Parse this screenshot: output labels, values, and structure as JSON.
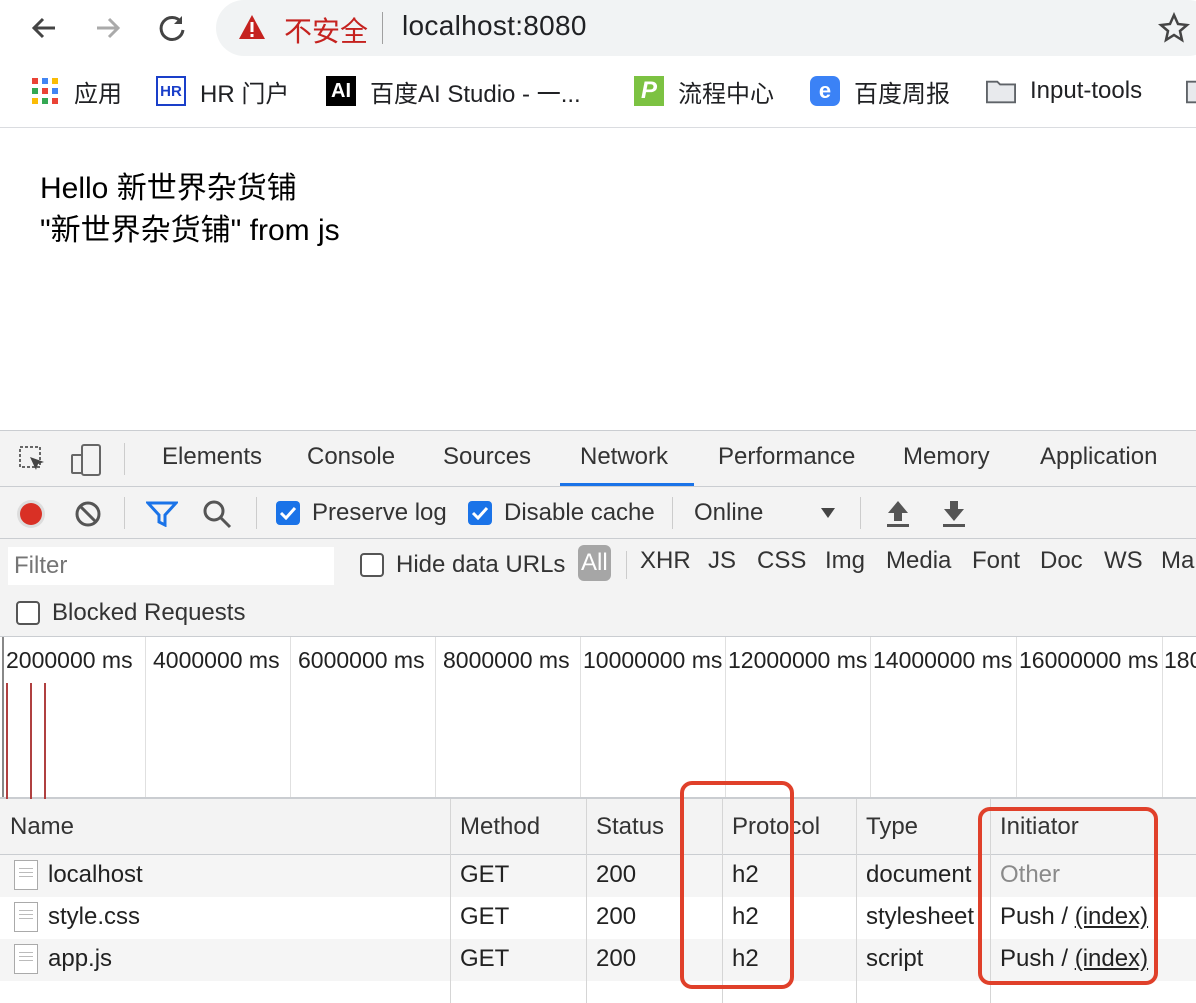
{
  "browser": {
    "insecure_label": "不安全",
    "url": "localhost:8080",
    "bookmarks": [
      {
        "icon": "apps-grid-icon",
        "label": "应用"
      },
      {
        "icon": "hr-portal-icon",
        "icon_text": "HR",
        "label": "HR 门户"
      },
      {
        "icon": "ai-studio-icon",
        "icon_text": "AI",
        "label": "百度AI Studio - 一..."
      },
      {
        "icon": "process-center-icon",
        "icon_text": "P",
        "label": "流程中心"
      },
      {
        "icon": "weekly-report-icon",
        "icon_text": "e",
        "label": "百度周报"
      },
      {
        "icon": "folder-icon",
        "label": "Input-tools"
      }
    ]
  },
  "page": {
    "line1": "Hello 新世界杂货铺",
    "line2": "\"新世界杂货铺\" from js"
  },
  "devtools": {
    "tabs": [
      "Elements",
      "Console",
      "Sources",
      "Network",
      "Performance",
      "Memory",
      "Application"
    ],
    "active_tab": "Network",
    "preserve_log": "Preserve log",
    "disable_cache": "Disable cache",
    "throttle": "Online",
    "filter_placeholder": "Filter",
    "hide_data_urls": "Hide data URLs",
    "type_filters": [
      "All",
      "XHR",
      "JS",
      "CSS",
      "Img",
      "Media",
      "Font",
      "Doc",
      "WS",
      "Ma"
    ],
    "blocked_requests": "Blocked Requests",
    "timeline_ticks": [
      "2000000 ms",
      "4000000 ms",
      "6000000 ms",
      "8000000 ms",
      "10000000 ms",
      "12000000 ms",
      "14000000 ms",
      "16000000 ms",
      "180"
    ],
    "columns": [
      "Name",
      "Method",
      "Status",
      "Protocol",
      "Type",
      "Initiator"
    ],
    "rows": [
      {
        "name": "localhost",
        "method": "GET",
        "status": "200",
        "protocol": "h2",
        "type": "document",
        "initiator": "Other",
        "initiator_link": ""
      },
      {
        "name": "style.css",
        "method": "GET",
        "status": "200",
        "protocol": "h2",
        "type": "stylesheet",
        "initiator": "Push / ",
        "initiator_link": "(index)"
      },
      {
        "name": "app.js",
        "method": "GET",
        "status": "200",
        "protocol": "h2",
        "type": "script",
        "initiator": "Push / ",
        "initiator_link": "(index)"
      }
    ]
  },
  "colors": {
    "accent": "#1a73e8",
    "record": "#d93025",
    "highlight": "#e0402a",
    "insecure": "#c5221f"
  }
}
